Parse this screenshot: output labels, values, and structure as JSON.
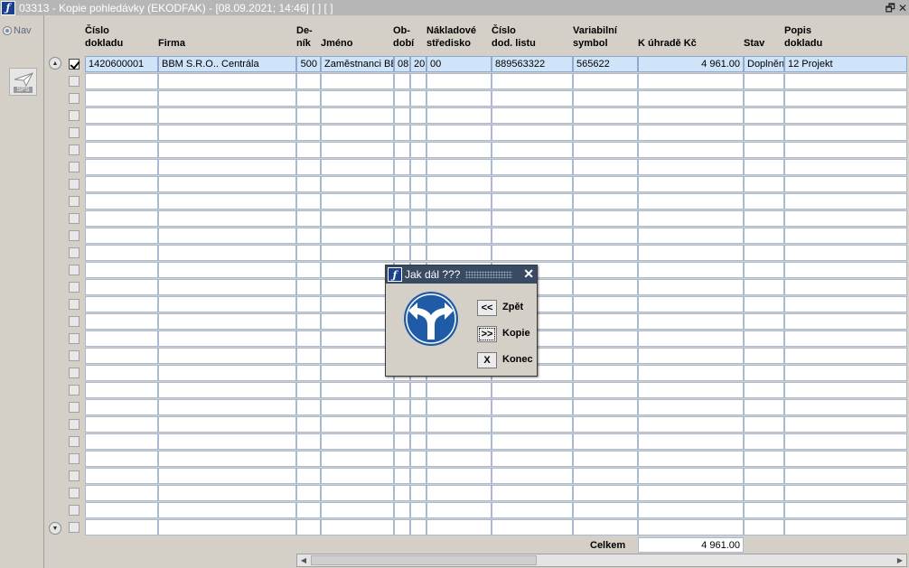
{
  "window": {
    "title": "03313 - Kopie pohledávky (EKODFAK) - [08.09.2021; 14:46]  [ ]  [ ]",
    "icon": "sf-logo-icon",
    "restore_glyph": "🗗",
    "close_glyph": "✕"
  },
  "nav": {
    "radio_label": "Nav",
    "sps_label": "SPS"
  },
  "table": {
    "headers": [
      {
        "key": "cislo",
        "label": "Číslo\ndokladu"
      },
      {
        "key": "firma",
        "label": "Firma"
      },
      {
        "key": "denik",
        "label": "De-\nník"
      },
      {
        "key": "jmeno",
        "label": "Jméno"
      },
      {
        "key": "obdobi",
        "label": "Ob-\ndobí"
      },
      {
        "key": "stredisko",
        "label": "Nákladové\nstředisko"
      },
      {
        "key": "dodlist",
        "label": "Číslo\ndod. listu"
      },
      {
        "key": "varsym",
        "label": "Variabilní\nsymbol"
      },
      {
        "key": "kuhrade",
        "label": "K úhradě Kč"
      },
      {
        "key": "stav",
        "label": "Stav"
      },
      {
        "key": "popis",
        "label": "Popis\ndokladu"
      }
    ],
    "rows": [
      {
        "checked": true,
        "selected": true,
        "cells": [
          "1420600001",
          "BBM S.R.O.. Centrála",
          "500",
          "Zaměstnanci BB",
          "08",
          "20",
          "00",
          "889563322",
          "565622",
          "4 961.00",
          "Doplněn",
          "12 Projekt"
        ]
      }
    ],
    "empty_row_count": 27,
    "scroll_up_glyph": "▲",
    "scroll_down_glyph": "▼"
  },
  "footer": {
    "total_label": "Celkem",
    "total_value": "4 961.00",
    "hscroll_left": "◀",
    "hscroll_right": "▶"
  },
  "dialog": {
    "title": "Jak dál ???",
    "close_glyph": "✕",
    "icon": "fork-arrow-sign-icon",
    "buttons": [
      {
        "glyph": "<<",
        "label": "Zpět",
        "focused": false
      },
      {
        "glyph": ">>",
        "label": "Kopie",
        "focused": true
      },
      {
        "glyph": "X",
        "label": "Konec",
        "focused": false
      }
    ]
  },
  "colors": {
    "selected_row": "#cfe4f8",
    "grid_border": "#a9b9cf",
    "dialog_title": "#394a63",
    "sign_blue": "#1f5ba6"
  }
}
